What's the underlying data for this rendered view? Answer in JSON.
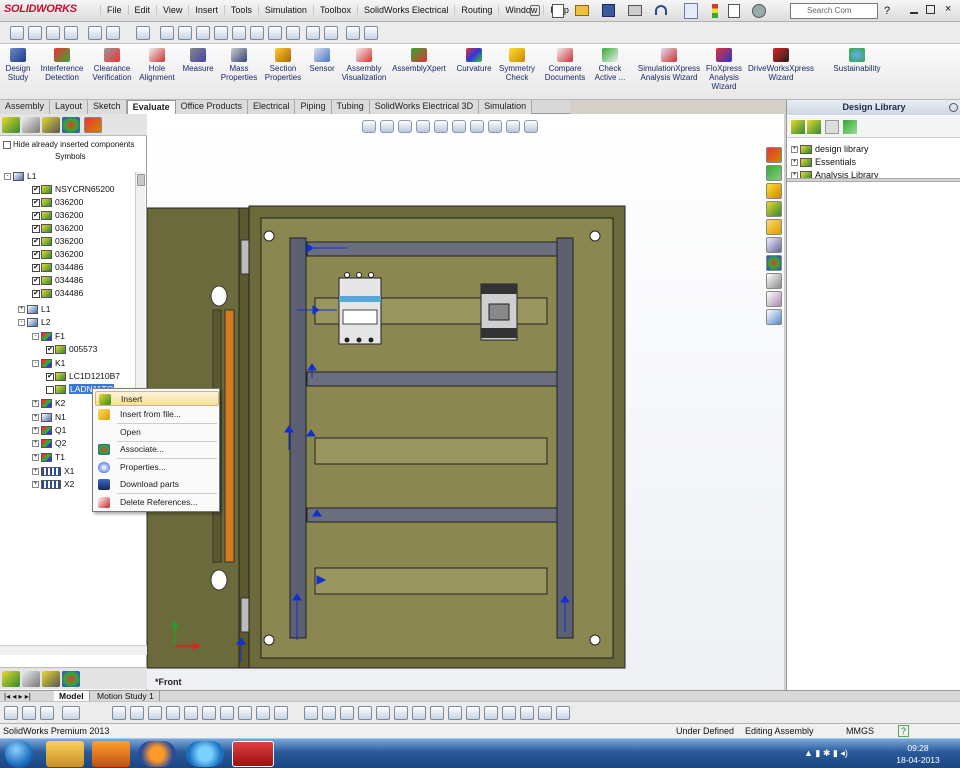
{
  "app": {
    "name": "SOLIDWORKS",
    "accent": "#c8102e"
  },
  "menu": [
    "File",
    "Edit",
    "View",
    "Insert",
    "Tools",
    "Simulation",
    "Toolbox",
    "SolidWorks Electrical",
    "Routing",
    "Window",
    "Help"
  ],
  "search": {
    "placeholder": "Search Com"
  },
  "commands": [
    {
      "label": "Design\nStudy",
      "icon": "design-study-icon"
    },
    {
      "label": "Interference\nDetection",
      "icon": "interference-icon"
    },
    {
      "label": "Clearance\nVerification",
      "icon": "clearance-icon"
    },
    {
      "label": "Hole\nAlignment",
      "icon": "hole-icon"
    },
    {
      "label": "Measure",
      "icon": "measure-icon"
    },
    {
      "label": "Mass\nProperties",
      "icon": "mass-icon"
    },
    {
      "label": "Section\nProperties",
      "icon": "section-icon"
    },
    {
      "label": "Sensor",
      "icon": "sensor-icon"
    },
    {
      "label": "Assembly\nVisualization",
      "icon": "assembly-vis-icon"
    },
    {
      "label": "AssemblyXpert",
      "icon": "assemblyxpert-icon"
    },
    {
      "label": "Curvature",
      "icon": "curvature-icon"
    },
    {
      "label": "Symmetry\nCheck",
      "icon": "symmetry-icon"
    },
    {
      "label": "Compare\nDocuments",
      "icon": "compare-icon"
    },
    {
      "label": "Check\nActive ...",
      "icon": "check-icon"
    },
    {
      "label": "SimulationXpress\nAnalysis Wizard",
      "icon": "simxpress-icon"
    },
    {
      "label": "FloXpress\nAnalysis\nWizard",
      "icon": "floxpress-icon"
    },
    {
      "label": "DriveWorksXpress\nWizard",
      "icon": "driveworks-icon"
    },
    {
      "label": "Sustainability",
      "icon": "sustainability-icon"
    }
  ],
  "tabs": [
    "Assembly",
    "Layout",
    "Sketch",
    "Evaluate",
    "Office Products",
    "Electrical",
    "Piping",
    "Tubing",
    "SolidWorks Electrical 3D",
    "Simulation"
  ],
  "active_tab": "Evaluate",
  "left_panel": {
    "hide_checkbox_label": "Hide already inserted components",
    "symbols_label": "Symbols",
    "tree": [
      {
        "label": "L1",
        "level": 0,
        "exp": "-",
        "icon": "blue",
        "cb": false
      },
      {
        "label": "NSYCRN65200",
        "level": 1,
        "cb": true,
        "icon": "green"
      },
      {
        "label": "036200",
        "level": 1,
        "cb": true,
        "icon": "green"
      },
      {
        "label": "036200",
        "level": 1,
        "cb": true,
        "icon": "green"
      },
      {
        "label": "036200",
        "level": 1,
        "cb": true,
        "icon": "green"
      },
      {
        "label": "036200",
        "level": 1,
        "cb": true,
        "icon": "green"
      },
      {
        "label": "036200",
        "level": 1,
        "cb": true,
        "icon": "green"
      },
      {
        "label": "034486",
        "level": 1,
        "cb": true,
        "icon": "green"
      },
      {
        "label": "034486",
        "level": 1,
        "cb": true,
        "icon": "green"
      },
      {
        "label": "034486",
        "level": 1,
        "cb": true,
        "icon": "green"
      },
      {
        "label": "L1",
        "level": 0.5,
        "exp": "+",
        "icon": "blue",
        "cb": false
      },
      {
        "label": "L2",
        "level": 0.5,
        "exp": "-",
        "icon": "blue",
        "cb": false
      },
      {
        "label": "F1",
        "level": 1,
        "exp": "-",
        "icon": "multi",
        "cb": false
      },
      {
        "label": "005573",
        "level": 2,
        "cb": true,
        "icon": "green"
      },
      {
        "label": "K1",
        "level": 1,
        "exp": "-",
        "icon": "multi",
        "cb": false
      },
      {
        "label": "LC1D1210B7",
        "level": 2,
        "cb": true,
        "icon": "green"
      },
      {
        "label": "LADN11TQ",
        "level": 2,
        "cb": false,
        "icon": "green",
        "selected": true
      },
      {
        "label": "K2",
        "level": 1,
        "exp": "+",
        "icon": "multi",
        "cb": false
      },
      {
        "label": "N1",
        "level": 1,
        "exp": "+",
        "icon": "blue",
        "cb": false
      },
      {
        "label": "Q1",
        "level": 1,
        "exp": "+",
        "icon": "multi",
        "cb": false
      },
      {
        "label": "Q2",
        "level": 1,
        "exp": "+",
        "icon": "multi",
        "cb": false
      },
      {
        "label": "T1",
        "level": 1,
        "exp": "+",
        "icon": "multi",
        "cb": false
      },
      {
        "label": "X1",
        "level": 1,
        "exp": "+",
        "icon": "coil",
        "cb": false
      },
      {
        "label": "X2",
        "level": 1,
        "exp": "+",
        "icon": "coil",
        "cb": false
      }
    ]
  },
  "context_menu": [
    {
      "label": "Insert",
      "icon": "insert-icon",
      "highlighted": true
    },
    {
      "label": "Insert from file...",
      "icon": "insert-file-icon"
    },
    {
      "label": "Open",
      "icon": ""
    },
    {
      "label": "Associate...",
      "icon": "associate-icon"
    },
    {
      "label": "Properties...",
      "icon": "properties-icon"
    },
    {
      "label": "Download parts",
      "icon": "download-icon"
    },
    {
      "label": "Delete References...",
      "icon": "delete-icon"
    }
  ],
  "graphics": {
    "view_label": "*Front",
    "panel_color": "#6b6a3a",
    "rail_color": "#5c6070"
  },
  "design_library": {
    "title": "Design Library",
    "items": [
      {
        "label": "design library",
        "exp": "+"
      },
      {
        "label": "Essentials",
        "exp": "+"
      },
      {
        "label": "Analysis Library",
        "exp": "+"
      }
    ]
  },
  "bottom_tabs": [
    "Model",
    "Motion Study 1"
  ],
  "active_bottom_tab": "Model",
  "status": {
    "product": "SolidWorks Premium 2013",
    "state": "Under Defined",
    "mode": "Editing Assembly",
    "units": "MMGS",
    "help": "?"
  },
  "taskbar": {
    "time": "09:28",
    "date": "18-04-2013"
  }
}
